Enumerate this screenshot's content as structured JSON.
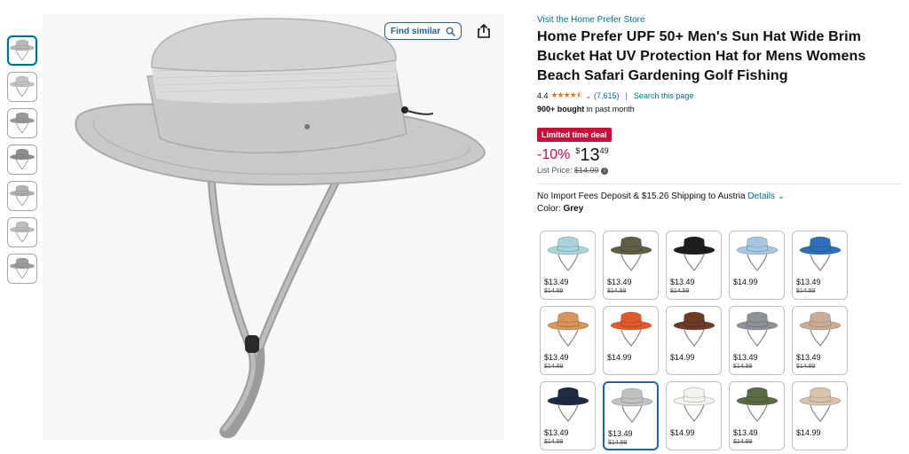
{
  "store_link": "Visit the Home Prefer Store",
  "product_title": "Home Prefer UPF 50+ Men's Sun Hat Wide Brim Bucket Hat UV Protection Hat for Mens Womens Beach Safari Gardening Golf Fishing",
  "rating": {
    "value": "4.4",
    "stars": "★★★★⯪",
    "count": "(7,615)",
    "search_link": "Search this page"
  },
  "bought": {
    "count": "900+ bought",
    "suffix": "in past month"
  },
  "deal_badge": "Limited time deal",
  "price": {
    "discount": "-10%",
    "currency": "$",
    "whole": "13",
    "fraction": "49"
  },
  "list_price": {
    "label": "List Price:",
    "value": "$14.99"
  },
  "shipping": {
    "text": "No Import Fees Deposit & $15.26 Shipping to Austria",
    "details": "Details"
  },
  "color": {
    "label": "Color:",
    "value": "Grey"
  },
  "find_similar": "Find similar",
  "icons": {
    "search": "search-icon",
    "share": "share-icon",
    "info": "info-icon",
    "chevron": "chevron-down-icon"
  },
  "colors": {
    "link": "#007185",
    "deal": "#cc0c39",
    "stars": "#de7921",
    "selected_border": "#2162a1"
  },
  "thumbnails": [
    {
      "name": "thumb-1",
      "color": "#b9b9b9"
    },
    {
      "name": "thumb-2",
      "color": "#c4c4c4"
    },
    {
      "name": "thumb-3",
      "color": "#9a9a9a"
    },
    {
      "name": "thumb-4",
      "color": "#8d8d8d"
    },
    {
      "name": "thumb-5",
      "color": "#b0b0b0"
    },
    {
      "name": "thumb-6",
      "color": "#bdbdbd"
    },
    {
      "name": "thumb-7",
      "color": "#9e9e9e"
    }
  ],
  "swatches": [
    {
      "color": "#a9d4dc",
      "price": "$13.49",
      "list": "$14.99"
    },
    {
      "color": "#5e5f45",
      "price": "$13.49",
      "list": "$14.99"
    },
    {
      "color": "#1e1e1e",
      "price": "$13.49",
      "list": "$14.99"
    },
    {
      "color": "#a7c7e0",
      "price": "$14.99",
      "list": ""
    },
    {
      "color": "#2f6fb8",
      "price": "$13.49",
      "list": "$14.99"
    },
    {
      "color": "#d8955a",
      "price": "$13.49",
      "list": "$14.99"
    },
    {
      "color": "#e05a2c",
      "price": "$14.99",
      "list": ""
    },
    {
      "color": "#6e3b27",
      "price": "$14.99",
      "list": ""
    },
    {
      "color": "#8e9296",
      "price": "$13.49",
      "list": "$14.99"
    },
    {
      "color": "#c9ad96",
      "price": "$13.49",
      "list": "$14.99"
    },
    {
      "color": "#1f2a44",
      "price": "$13.49",
      "list": "$14.99"
    },
    {
      "color": "#c2c2c2",
      "price": "$13.49",
      "list": "$14.99"
    },
    {
      "color": "#f2f2ee",
      "price": "$14.99",
      "list": ""
    },
    {
      "color": "#5a6b45",
      "price": "$13.49",
      "list": "$14.99"
    },
    {
      "color": "#d9c2aa",
      "price": "$14.99",
      "list": ""
    }
  ],
  "selected_swatch_index": 11
}
